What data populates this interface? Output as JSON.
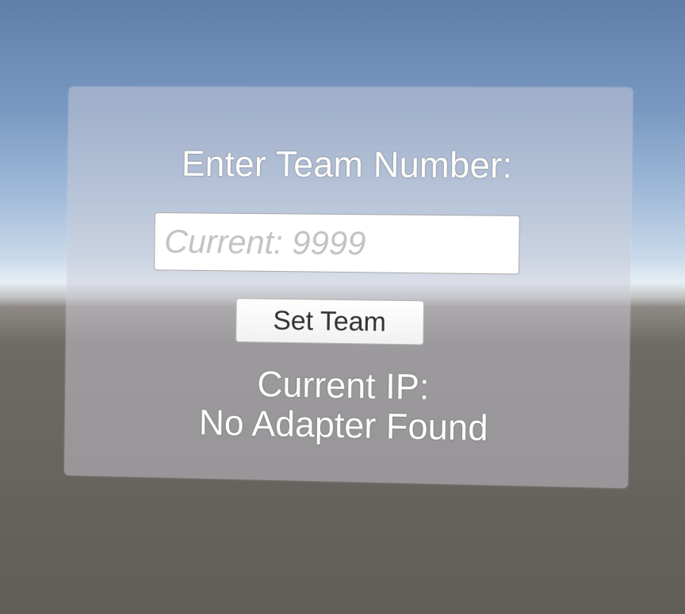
{
  "panel": {
    "title": "Enter Team Number:",
    "team_input": {
      "value": "",
      "placeholder": "Current: 9999"
    },
    "set_team_button": "Set Team",
    "ip_label": "Current IP:",
    "ip_value": "No Adapter Found"
  }
}
